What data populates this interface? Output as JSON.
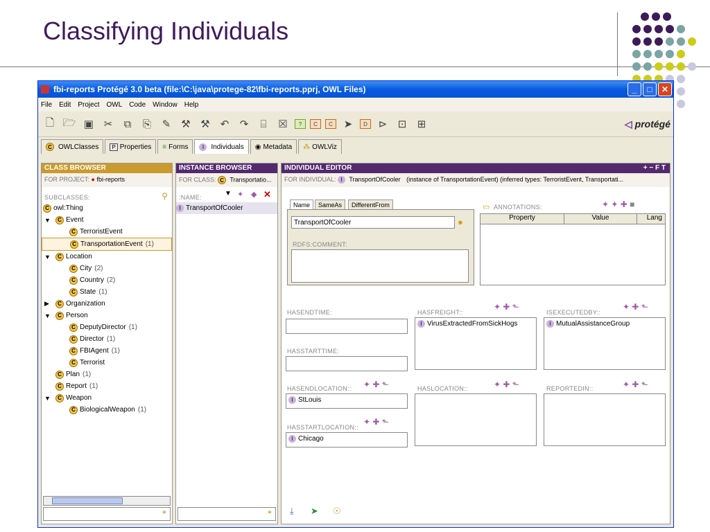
{
  "slide": {
    "title": "Classifying Individuals"
  },
  "window": {
    "title": "fbi-reports  Protégé 3.0 beta    (file:\\C:\\java\\protege-82\\fbi-reports.pprj, OWL Files)",
    "menu": [
      "File",
      "Edit",
      "Project",
      "OWL",
      "Code",
      "Window",
      "Help"
    ],
    "logo": "protégé"
  },
  "tabs": [
    "OWLClasses",
    "Properties",
    "Forms",
    "Individuals",
    "Metadata",
    "OWLViz"
  ],
  "class_browser": {
    "header": "CLASS BROWSER",
    "for_project_label": "FOR PROJECT:",
    "project": "fbi-reports",
    "subclasses_label": "SUBCLASSES:",
    "tree": [
      {
        "label": "owl:Thing",
        "count": "",
        "indent": 0,
        "toggle": ""
      },
      {
        "label": "Event",
        "count": "",
        "indent": 1,
        "toggle": "▼"
      },
      {
        "label": "TerroristEvent",
        "count": "",
        "indent": 2,
        "toggle": ""
      },
      {
        "label": "TransportationEvent",
        "count": "(1)",
        "indent": 2,
        "toggle": "",
        "selected": true
      },
      {
        "label": "Location",
        "count": "",
        "indent": 1,
        "toggle": "▼"
      },
      {
        "label": "City",
        "count": "(2)",
        "indent": 2,
        "toggle": ""
      },
      {
        "label": "Country",
        "count": "(2)",
        "indent": 2,
        "toggle": ""
      },
      {
        "label": "State",
        "count": "(1)",
        "indent": 2,
        "toggle": ""
      },
      {
        "label": "Organization",
        "count": "",
        "indent": 1,
        "toggle": "▶"
      },
      {
        "label": "Person",
        "count": "",
        "indent": 1,
        "toggle": "▼"
      },
      {
        "label": "DeputyDirector",
        "count": "(1)",
        "indent": 2,
        "toggle": ""
      },
      {
        "label": "Director",
        "count": "(1)",
        "indent": 2,
        "toggle": ""
      },
      {
        "label": "FBIAgent",
        "count": "(1)",
        "indent": 2,
        "toggle": ""
      },
      {
        "label": "Terrorist",
        "count": "",
        "indent": 2,
        "toggle": ""
      },
      {
        "label": "Plan",
        "count": "(1)",
        "indent": 1,
        "toggle": ""
      },
      {
        "label": "Report",
        "count": "(1)",
        "indent": 1,
        "toggle": ""
      },
      {
        "label": "Weapon",
        "count": "",
        "indent": 1,
        "toggle": "▼"
      },
      {
        "label": "BiologicalWeapon",
        "count": "(1)",
        "indent": 2,
        "toggle": ""
      }
    ]
  },
  "instance_browser": {
    "header": "INSTANCE BROWSER",
    "for_class_label": "FOR CLASS:",
    "class": "Transportatio...",
    "name_label": ":NAME:",
    "instances": [
      "TransportOfCooler"
    ]
  },
  "individual_editor": {
    "header": "INDIVIDUAL EDITOR",
    "header_buttons": "+ − F T",
    "for_individual_label": "FOR INDIVIDUAL:",
    "individual": "TransportOfCooler",
    "instance_info": "(instance of TransportationEvent)  (inferred types: TerroristEvent, Transportati...",
    "subtabs": [
      "Name",
      "SameAs",
      "DifferentFrom"
    ],
    "name_value": "TransportOfCooler",
    "rdfs_comment_label": "RDFS:COMMENT:",
    "annotations_label": "ANNOTATIONS:",
    "annotation_columns": [
      "Property",
      "Value",
      "Lang"
    ],
    "fields": {
      "hasendtime": {
        "label": "HASENDTIME:",
        "value": ""
      },
      "hasstarttime": {
        "label": "HASSTARTTIME:",
        "value": ""
      },
      "hasendlocation": {
        "label": "HASENDLOCATION::",
        "value": "StLouis"
      },
      "hasstartlocation": {
        "label": "HASSTARTLOCATION::",
        "value": "Chicago"
      },
      "hasfreight": {
        "label": "HASFREIGHT::",
        "value": "VirusExtractedFromSickHogs"
      },
      "haslocation": {
        "label": "HASLOCATION::",
        "value": ""
      },
      "isexecutedby": {
        "label": "ISEXECUTEDBY::",
        "value": "MutualAssistanceGroup"
      },
      "reportedin": {
        "label": "REPORTEDIN::",
        "value": ""
      }
    }
  },
  "colors": {
    "class_header": "#c99a2e",
    "purple_header": "#54296e",
    "title": "#3f1a5c"
  }
}
